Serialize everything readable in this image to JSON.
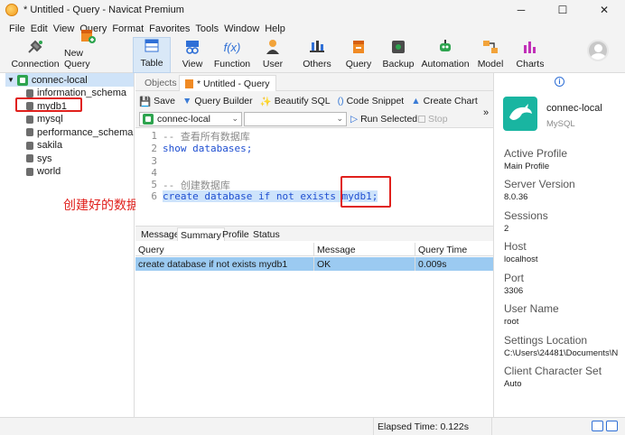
{
  "window": {
    "title": "* Untitled - Query - Navicat Premium",
    "controls": [
      "─",
      "☐",
      "✕"
    ]
  },
  "menu": [
    "File",
    "Edit",
    "View",
    "Query",
    "Format",
    "Favorites",
    "Tools",
    "Window",
    "Help"
  ],
  "toolbar": {
    "connection": "Connection",
    "new_query": "New Query",
    "table": "Table",
    "view": "View",
    "function": "Function",
    "user": "User",
    "others": "Others",
    "query": "Query",
    "backup": "Backup",
    "automation": "Automation",
    "model": "Model",
    "charts": "Charts"
  },
  "sidebar": {
    "connection": "connec-local",
    "databases": [
      "information_schema",
      "mydb1",
      "mysql",
      "performance_schema",
      "sakila",
      "sys",
      "world"
    ]
  },
  "annotation": "创建好的数据库",
  "tabs": {
    "objects": "Objects",
    "query_tab": "* Untitled - Query"
  },
  "query_toolbar": {
    "save": "Save",
    "query_builder": "Query Builder",
    "beautify": "Beautify SQL",
    "code_snippet": "Code Snippet",
    "create_chart": "Create Chart"
  },
  "selectors": {
    "connection": "connec-local",
    "database": "",
    "run_selected": "Run Selected",
    "stop": "Stop"
  },
  "editor": {
    "lines": [
      {
        "n": "1",
        "text": "--  查看所有数据库"
      },
      {
        "n": "2",
        "text": "show databases;"
      },
      {
        "n": "3",
        "text": ""
      },
      {
        "n": "4",
        "text": ""
      },
      {
        "n": "5",
        "text": "--  创建数据库"
      },
      {
        "n": "6",
        "text": "create database if not exists mydb1;"
      }
    ]
  },
  "result_tabs": [
    "Message",
    "Summary",
    "Profile",
    "Status"
  ],
  "result": {
    "headers": [
      "Query",
      "Message",
      "Query Time"
    ],
    "rows": [
      [
        "create database if not exists mydb1",
        "OK",
        "0.009s"
      ]
    ]
  },
  "info": {
    "connection_name": "connec-local",
    "connection_type": "MySQL",
    "fields": [
      {
        "label": "Active Profile",
        "value": "Main Profile"
      },
      {
        "label": "Server Version",
        "value": "8.0.36"
      },
      {
        "label": "Sessions",
        "value": "2"
      },
      {
        "label": "Host",
        "value": "localhost"
      },
      {
        "label": "Port",
        "value": "3306"
      },
      {
        "label": "User Name",
        "value": "root"
      },
      {
        "label": "Settings Location",
        "value": "C:\\Users\\24481\\Documents\\N"
      },
      {
        "label": "Client Character Set",
        "value": "Auto"
      }
    ]
  },
  "status": {
    "elapsed": "Elapsed Time: 0.122s"
  }
}
